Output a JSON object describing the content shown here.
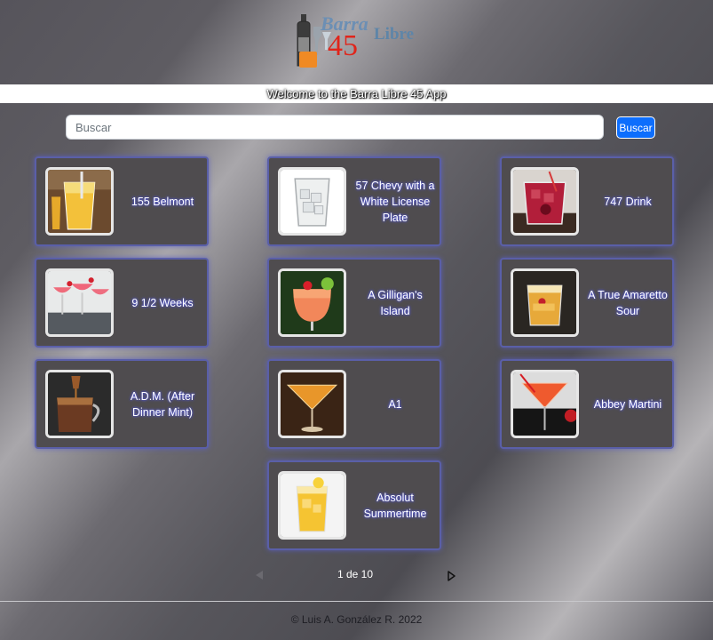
{
  "app": {
    "logo_text_top": "Barra",
    "logo_number": "45",
    "logo_text_side": "Libre",
    "welcome": "Welcome to the Barra Libre 45 App"
  },
  "search": {
    "placeholder": "Buscar",
    "value": "",
    "button_label": "Buscar"
  },
  "drinks": [
    {
      "name": "155 Belmont"
    },
    {
      "name": "57 Chevy with a White License Plate"
    },
    {
      "name": "747 Drink"
    },
    {
      "name": "9 1/2 Weeks"
    },
    {
      "name": "A Gilligan's Island"
    },
    {
      "name": "A True Amaretto Sour"
    },
    {
      "name": "A.D.M. (After Dinner Mint)"
    },
    {
      "name": "A1"
    },
    {
      "name": "Abbey Martini"
    },
    {
      "name": "Absolut Summertime"
    }
  ],
  "pagination": {
    "label": "1 de 10",
    "prev_icon": "chevron-left-icon",
    "next_icon": "chevron-right-icon"
  },
  "footer": {
    "text": "© Luis A. González R. 2022"
  },
  "colors": {
    "button_primary": "#0d6efd",
    "card_bg": "#4f4c4f",
    "card_border": "#5a5fa8",
    "logo_red": "#e0251b",
    "logo_blue": "#6c8fb4"
  }
}
